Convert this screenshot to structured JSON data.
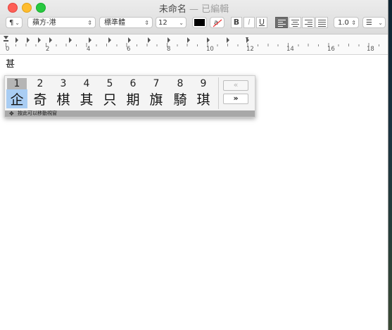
{
  "window": {
    "title": "未命名",
    "title_separator": "—",
    "title_status": "已編輯"
  },
  "toolbar": {
    "paragraph_style": "¶",
    "font_family": "蘋方-港",
    "font_style": "標準體",
    "font_size": "12",
    "text_color": "#000000",
    "bold_label": "B",
    "italic_label": "I",
    "underline_label": "U",
    "alignment_selected": "left",
    "line_spacing": "1.0",
    "list_label": "☰"
  },
  "ruler": {
    "labels": [
      "0",
      "2",
      "4",
      "6",
      "8",
      "10",
      "12",
      "14",
      "16",
      "18"
    ]
  },
  "document": {
    "text": "甚"
  },
  "candidates": {
    "selected_index": 0,
    "items": [
      {
        "number": "1",
        "char": "企"
      },
      {
        "number": "2",
        "char": "奇"
      },
      {
        "number": "3",
        "char": "棋"
      },
      {
        "number": "4",
        "char": "其"
      },
      {
        "number": "5",
        "char": "只"
      },
      {
        "number": "6",
        "char": "期"
      },
      {
        "number": "7",
        "char": "旗"
      },
      {
        "number": "8",
        "char": "騎"
      },
      {
        "number": "9",
        "char": "琪"
      }
    ],
    "prev_page": "«",
    "next_page": "»",
    "footer_hint": "按此可以移動視窗",
    "move_icon": "✥"
  },
  "colors": {
    "close": "#fe5f57",
    "minimize": "#febc2e",
    "zoom": "#28c840",
    "selection": "#a9cdf3"
  }
}
